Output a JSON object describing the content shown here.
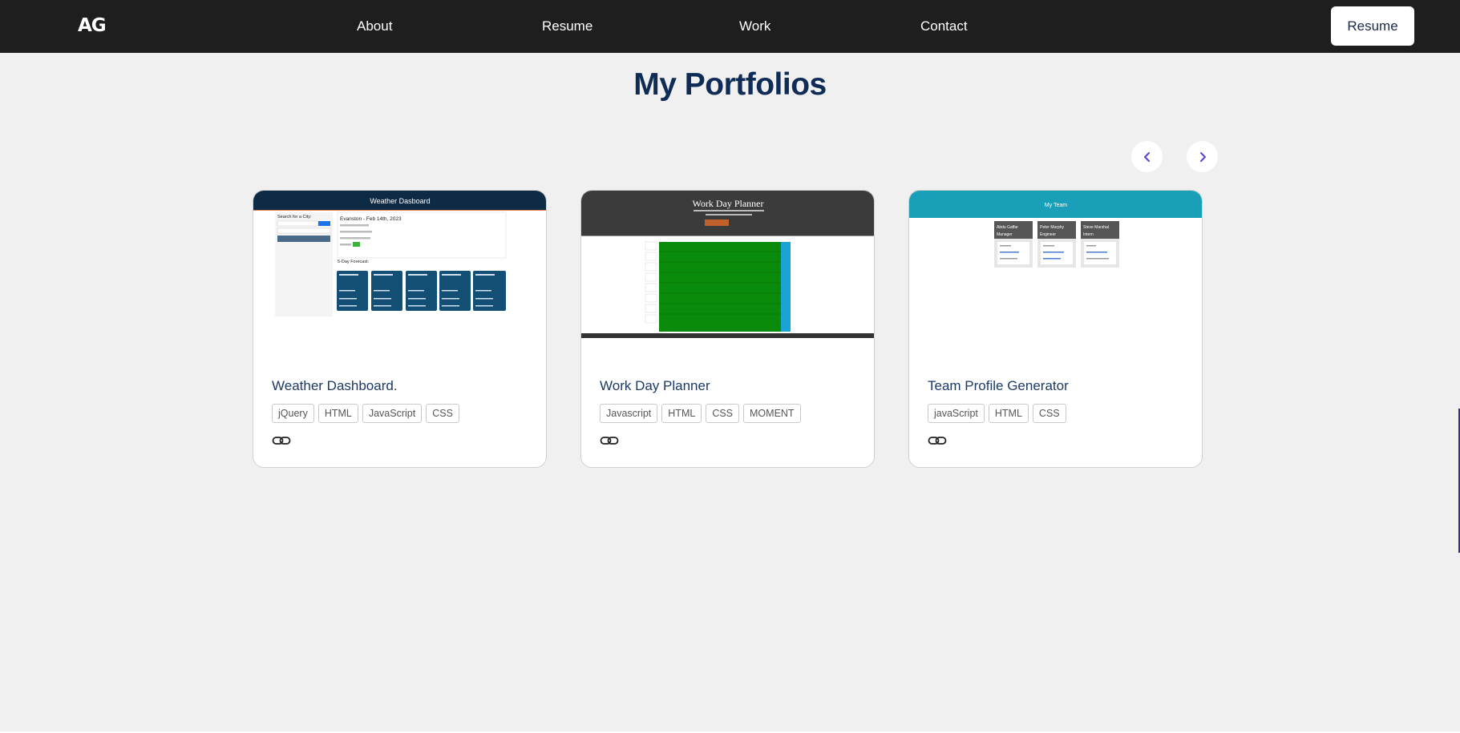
{
  "nav": {
    "logo": "AG",
    "links": [
      "About",
      "Resume",
      "Work",
      "Contact"
    ],
    "button": "Resume"
  },
  "section": {
    "title": "My Portfolios"
  },
  "carousel": {
    "prev_icon": "chevron-left-icon",
    "next_icon": "chevron-right-icon",
    "arrow_color": "#5a3fd8"
  },
  "projects": [
    {
      "title": "Weather Dashboard.",
      "tags": [
        "jQuery",
        "HTML",
        "JavaScript",
        "CSS"
      ],
      "link_icon": "link-icon",
      "preview": {
        "header": "Weather Dasboard",
        "search_label": "Search for a City:",
        "city_line": "Evanston - Feb 14th, 2023",
        "forecast_label": "5-Day Forecast:",
        "header_color": "#0d2b45",
        "tile_color": "#134e75"
      }
    },
    {
      "title": "Work Day Planner",
      "tags": [
        "Javascript",
        "HTML",
        "CSS",
        "MOMENT"
      ],
      "link_icon": "link-icon",
      "preview": {
        "header": "Work Day Planner",
        "header_color": "#3b3b3b",
        "block_color": "#0a8a0a",
        "save_color": "#1aa3d6"
      }
    },
    {
      "title": "Team Profile Generator",
      "tags": [
        "javaScript",
        "HTML",
        "CSS"
      ],
      "link_icon": "link-icon",
      "preview": {
        "header": "My Team",
        "header_color": "#1a9fb8",
        "members": [
          {
            "name": "Abdu Gaffar",
            "role": "Manager"
          },
          {
            "name": "Peter Murphy",
            "role": "Engineer"
          },
          {
            "name": "Steve Marshal",
            "role": "Intern"
          }
        ]
      }
    }
  ]
}
